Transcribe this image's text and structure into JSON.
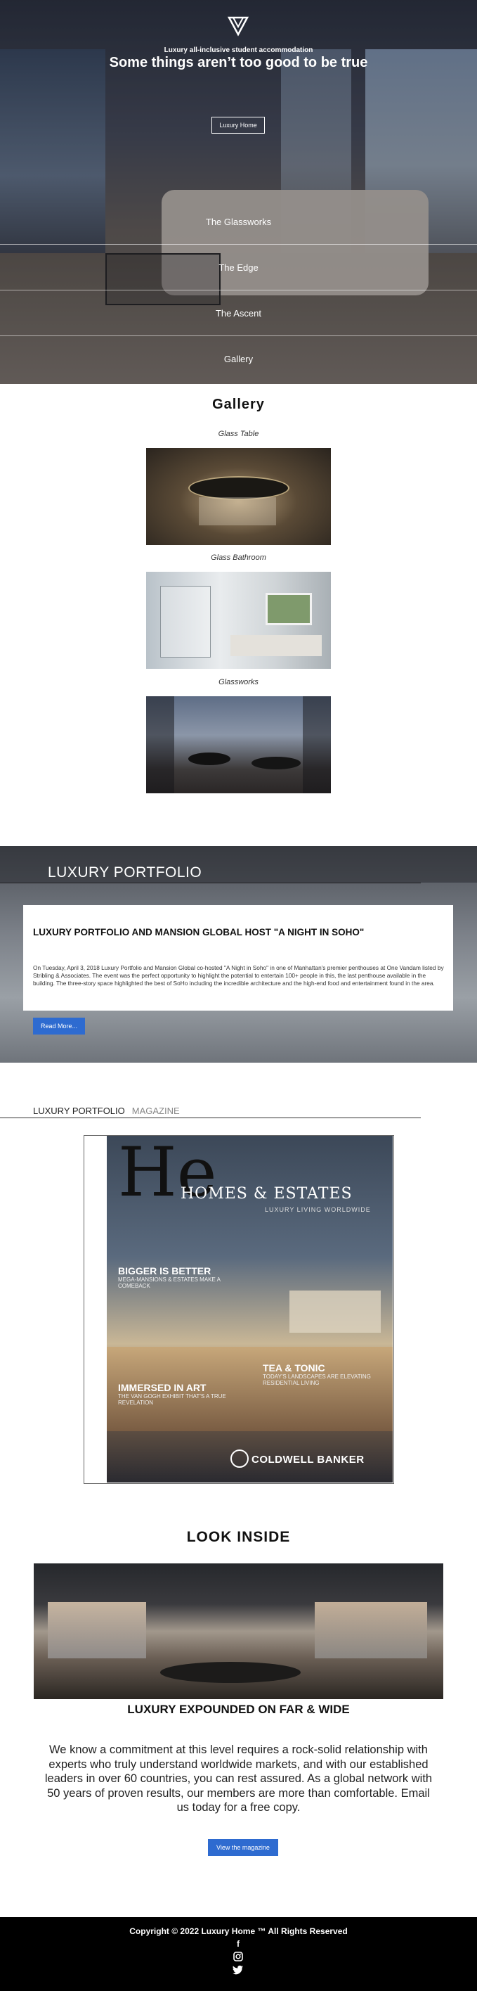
{
  "hero": {
    "subtitle": "Luxury all-inclusive student accommodation",
    "title": "Some things aren’t too good to be true",
    "button": "Luxury Home",
    "nav": [
      "The Glassworks",
      "The Edge",
      "The Ascent",
      "Gallery"
    ]
  },
  "gallery": {
    "title": "Gallery",
    "items": [
      "Glass Table",
      "Glass Bathroom",
      "Glassworks"
    ]
  },
  "portfolio": {
    "heading": "LUXURY PORTFOLIO",
    "card_title": "LUXURY PORTFOLIO AND MANSION GLOBAL HOST \"A NIGHT IN SOHO\"",
    "card_body": "On Tuesday, April 3, 2018 Luxury Portfolio and Mansion Global co-hosted \"A Night in Soho\" in one of Manhattan's premier penthouses at One Vandam listed by Stribling & Associates. The event was the perfect opportunity to highlight the potential to entertain 100+ people in this, the last penthouse available in the building. The three-story space highlighted the best of SoHo including the incredible architecture and the high-end food and entertainment found in the area.",
    "button": "Read More..."
  },
  "magazine": {
    "tab_active": "LUXURY PORTFOLIO",
    "tab_inactive": "MAGAZINE",
    "cover": {
      "logo_letters": "He",
      "masthead": "HOMES & ESTATES",
      "tagline": "LUXURY LIVING WORLDWIDE",
      "h1": "BIGGER IS BETTER",
      "s1": "MEGA-MANSIONS & ESTATES MAKE A COMEBACK",
      "h2": "TEA & TONIC",
      "s2": "TODAY'S LANDSCAPES ARE ELEVATING RESIDENTIAL LIVING",
      "h3": "IMMERSED IN ART",
      "s3": "THE VAN GOGH EXHIBIT THAT'S A TRUE REVELATION",
      "brand": "COLDWELL BANKER"
    }
  },
  "look_inside": {
    "title": "LOOK INSIDE",
    "subtitle": "LUXURY EXPOUNDED ON FAR & WIDE",
    "body": "We know a commitment at this level requires a rock-solid relationship with experts who truly understand worldwide markets, and with our established leaders in over 60 countries, you can rest assured. As a global network with 50 years of proven results, our members are more than comfortable. Email us today for a free copy.",
    "button": "View the magazine"
  },
  "footer": {
    "copyright": "Copyright © 2022 Luxury Home ™ All Rights Reserved",
    "social": [
      "facebook-icon",
      "instagram-icon",
      "twitter-icon"
    ]
  }
}
